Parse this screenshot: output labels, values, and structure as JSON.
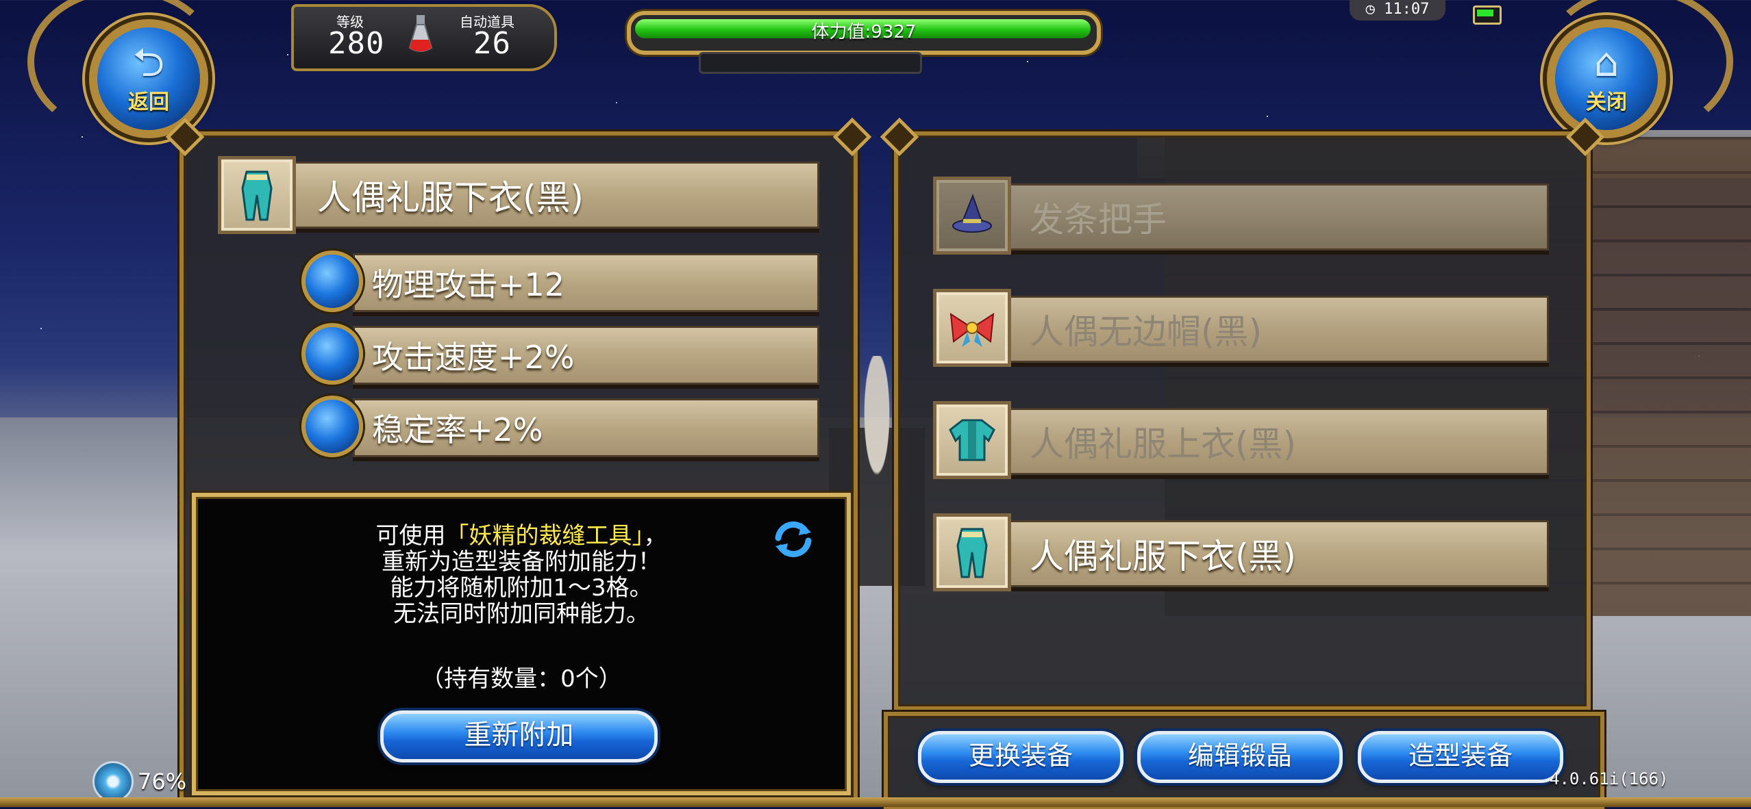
{
  "hud": {
    "back_label": "返回",
    "close_label": "关闭",
    "level_label": "等级",
    "level_value": "280",
    "auto_item_label": "自动道具",
    "auto_item_value": "26",
    "stamina_text": "体力值:9327",
    "stamina_fill_fraction": 0.995,
    "time": "11:07",
    "battery_color": "#2ee52e"
  },
  "left_panel": {
    "selected_item": {
      "name": "人偶礼服下衣(黑)",
      "icon": "armor-legs-icon"
    },
    "abilities": [
      {
        "text": "物理攻击+12"
      },
      {
        "text": "攻击速度+2%"
      },
      {
        "text": "稳定率+2%"
      }
    ],
    "info": {
      "line1_prefix": "可使用",
      "line1_highlight": "「妖精的裁缝工具」",
      "line1_suffix": "，",
      "line2": "重新为造型装备附加能力！",
      "line3": "能力将随机附加1～3格。",
      "line4": "无法同时附加同种能力。",
      "count": "（持有数量：0个）",
      "highlight_color": "#ffe94d"
    },
    "reattach_button": "重新附加"
  },
  "right_panel": {
    "items": [
      {
        "name": "发条把手",
        "icon": "wizard-hat-icon",
        "state": "dark"
      },
      {
        "name": "人偶无边帽(黑)",
        "icon": "ribbon-bow-icon",
        "state": "dim"
      },
      {
        "name": "人偶礼服上衣(黑)",
        "icon": "armor-top-icon",
        "state": "dim"
      },
      {
        "name": "人偶礼服下衣(黑)",
        "icon": "armor-legs-icon",
        "state": "active"
      }
    ]
  },
  "bottom_bar": {
    "change_equip": "更换装备",
    "edit_crystal": "编辑锻晶",
    "style_equip": "造型装备"
  },
  "footer": {
    "percent": "76%",
    "version": "4.0.61i(166)"
  }
}
